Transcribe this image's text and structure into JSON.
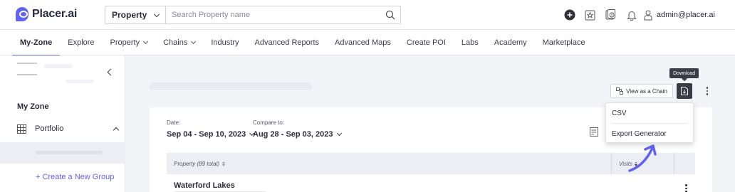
{
  "brand": {
    "name": "Placer.ai",
    "accent": "#5e63f1"
  },
  "search": {
    "type_label": "Property",
    "placeholder": "Search Property name"
  },
  "header": {
    "user": "admin@placer.ai",
    "icons": [
      "plus-circle-icon",
      "star-icon",
      "downloads-icon",
      "bell-icon",
      "user-icon"
    ]
  },
  "nav": {
    "items": [
      {
        "label": "My-Zone",
        "active": true
      },
      {
        "label": "Explore"
      },
      {
        "label": "Property",
        "dropdown": true
      },
      {
        "label": "Chains",
        "dropdown": true
      },
      {
        "label": "Industry"
      },
      {
        "label": "Advanced Reports"
      },
      {
        "label": "Advanced Maps"
      },
      {
        "label": "Create POI"
      },
      {
        "label": "Labs"
      },
      {
        "label": "Academy"
      },
      {
        "label": "Marketplace"
      }
    ]
  },
  "sidebar": {
    "title": "My Zone",
    "portfolio": "Portfolio",
    "create_group": "+ Create a New Group"
  },
  "toolbar": {
    "tooltip": "Download",
    "view_chain": "View as a Chain"
  },
  "dates": {
    "date_label": "Date:",
    "date_value": "Sep 04 - Sep 10, 2023",
    "compare_label": "Compare to:",
    "compare_value": "Aug 28 - Sep 03, 2023"
  },
  "table": {
    "col_property": "Property (89 total)",
    "col_visits": "Visits",
    "rows": [
      {
        "name": "Waterford Lakes"
      }
    ]
  },
  "download_menu": {
    "items": [
      "CSV",
      "Export Generator"
    ]
  }
}
